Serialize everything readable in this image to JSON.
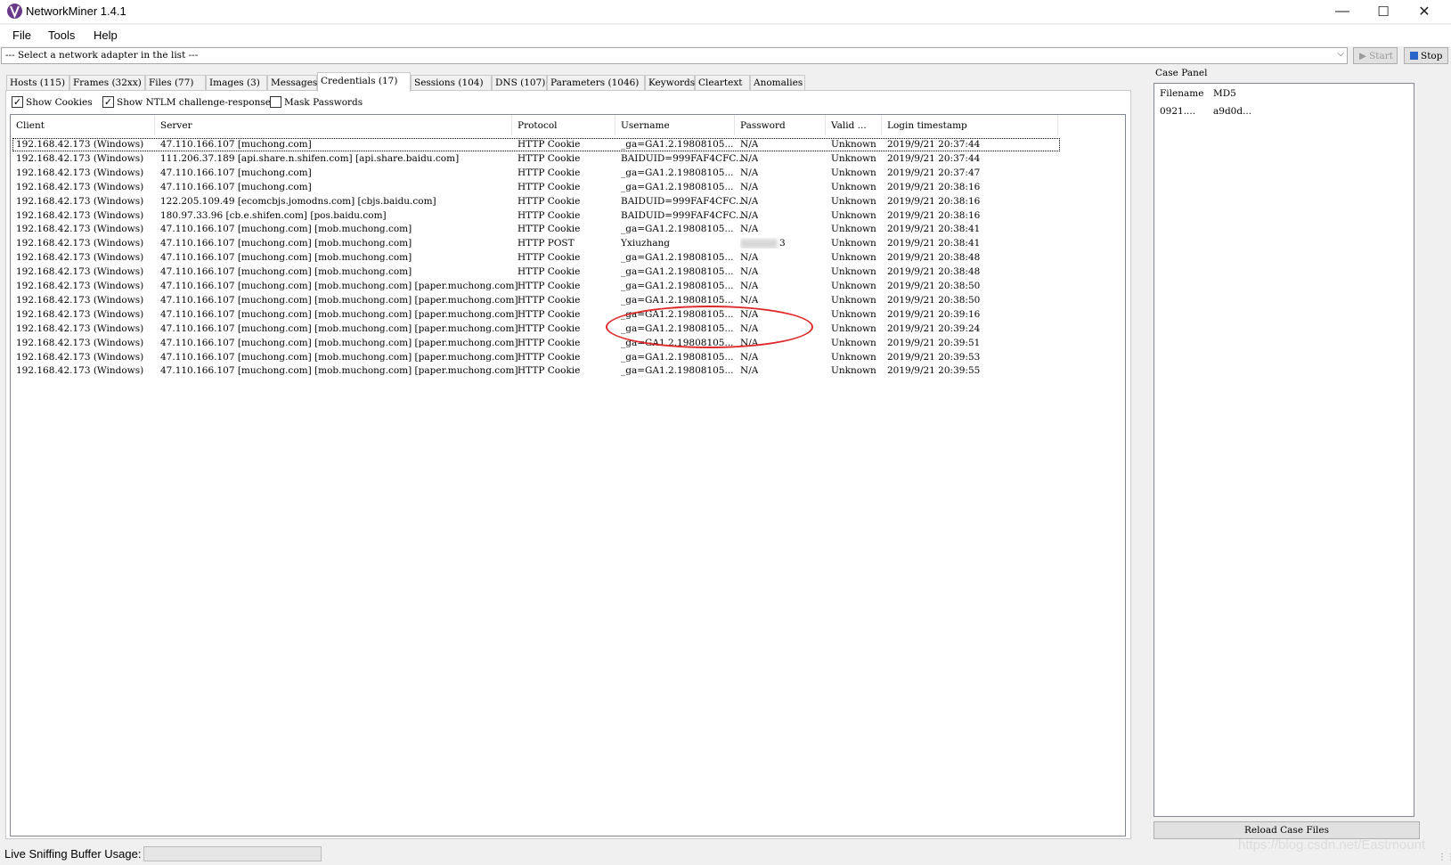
{
  "window": {
    "title": "NetworkMiner 1.4.1",
    "minimize": "—",
    "maximize": "☐",
    "close": "✕"
  },
  "menu": [
    "File",
    "Tools",
    "Help"
  ],
  "adapter": {
    "text": "--- Select a network adapter in the list ---"
  },
  "toolbar": {
    "start_label": "Start",
    "stop_label": "Stop"
  },
  "tabs": [
    "Hosts (115)",
    "Frames (32xx)",
    "Files (77)",
    "Images (3)",
    "Messages",
    "Credentials (17)",
    "Sessions (104)",
    "DNS (107)",
    "Parameters (1046)",
    "Keywords",
    "Cleartext",
    "Anomalies"
  ],
  "options": {
    "show_cookies": "Show Cookies",
    "show_ntlm": "Show NTLM challenge-response",
    "mask_passwords": "Mask Passwords"
  },
  "columns": [
    "Client",
    "Server",
    "Protocol",
    "Username",
    "Password",
    "Valid ...",
    "Login timestamp"
  ],
  "rows": [
    [
      "192.168.42.173 (Windows)",
      "47.110.166.107 [muchong.com]",
      "HTTP Cookie",
      "_ga=GA1.2.19808105...",
      "N/A",
      "Unknown",
      "2019/9/21 20:37:44"
    ],
    [
      "192.168.42.173 (Windows)",
      "111.206.37.189 [api.share.n.shifen.com] [api.share.baidu.com]",
      "HTTP Cookie",
      "BAIDUID=999FAF4CFC...",
      "N/A",
      "Unknown",
      "2019/9/21 20:37:44"
    ],
    [
      "192.168.42.173 (Windows)",
      "47.110.166.107 [muchong.com]",
      "HTTP Cookie",
      "_ga=GA1.2.19808105...",
      "N/A",
      "Unknown",
      "2019/9/21 20:37:47"
    ],
    [
      "192.168.42.173 (Windows)",
      "47.110.166.107 [muchong.com]",
      "HTTP Cookie",
      "_ga=GA1.2.19808105...",
      "N/A",
      "Unknown",
      "2019/9/21 20:38:16"
    ],
    [
      "192.168.42.173 (Windows)",
      "122.205.109.49 [ecomcbjs.jomodns.com] [cbjs.baidu.com]",
      "HTTP Cookie",
      "BAIDUID=999FAF4CFC...",
      "N/A",
      "Unknown",
      "2019/9/21 20:38:16"
    ],
    [
      "192.168.42.173 (Windows)",
      "180.97.33.96 [cb.e.shifen.com] [pos.baidu.com]",
      "HTTP Cookie",
      "BAIDUID=999FAF4CFC...",
      "N/A",
      "Unknown",
      "2019/9/21 20:38:16"
    ],
    [
      "192.168.42.173 (Windows)",
      "47.110.166.107 [muchong.com] [mob.muchong.com]",
      "HTTP Cookie",
      "_ga=GA1.2.19808105...",
      "N/A",
      "Unknown",
      "2019/9/21 20:38:41"
    ],
    [
      "192.168.42.173 (Windows)",
      "47.110.166.107 [muchong.com] [mob.muchong.com]",
      "HTTP POST",
      "Yxiuzhang",
      "3",
      "Unknown",
      "2019/9/21 20:38:41"
    ],
    [
      "192.168.42.173 (Windows)",
      "47.110.166.107 [muchong.com] [mob.muchong.com]",
      "HTTP Cookie",
      "_ga=GA1.2.19808105...",
      "N/A",
      "Unknown",
      "2019/9/21 20:38:48"
    ],
    [
      "192.168.42.173 (Windows)",
      "47.110.166.107 [muchong.com] [mob.muchong.com]",
      "HTTP Cookie",
      "_ga=GA1.2.19808105...",
      "N/A",
      "Unknown",
      "2019/9/21 20:38:48"
    ],
    [
      "192.168.42.173 (Windows)",
      "47.110.166.107 [muchong.com] [mob.muchong.com] [paper.muchong.com]",
      "HTTP Cookie",
      "_ga=GA1.2.19808105...",
      "N/A",
      "Unknown",
      "2019/9/21 20:38:50"
    ],
    [
      "192.168.42.173 (Windows)",
      "47.110.166.107 [muchong.com] [mob.muchong.com] [paper.muchong.com]",
      "HTTP Cookie",
      "_ga=GA1.2.19808105...",
      "N/A",
      "Unknown",
      "2019/9/21 20:38:50"
    ],
    [
      "192.168.42.173 (Windows)",
      "47.110.166.107 [muchong.com] [mob.muchong.com] [paper.muchong.com]",
      "HTTP Cookie",
      "_ga=GA1.2.19808105...",
      "N/A",
      "Unknown",
      "2019/9/21 20:39:16"
    ],
    [
      "192.168.42.173 (Windows)",
      "47.110.166.107 [muchong.com] [mob.muchong.com] [paper.muchong.com]",
      "HTTP Cookie",
      "_ga=GA1.2.19808105...",
      "N/A",
      "Unknown",
      "2019/9/21 20:39:24"
    ],
    [
      "192.168.42.173 (Windows)",
      "47.110.166.107 [muchong.com] [mob.muchong.com] [paper.muchong.com]",
      "HTTP Cookie",
      "_ga=GA1.2.19808105...",
      "N/A",
      "Unknown",
      "2019/9/21 20:39:51"
    ],
    [
      "192.168.42.173 (Windows)",
      "47.110.166.107 [muchong.com] [mob.muchong.com] [paper.muchong.com]",
      "HTTP Cookie",
      "_ga=GA1.2.19808105...",
      "N/A",
      "Unknown",
      "2019/9/21 20:39:53"
    ],
    [
      "192.168.42.173 (Windows)",
      "47.110.166.107 [muchong.com] [mob.muchong.com] [paper.muchong.com]",
      "HTTP Cookie",
      "_ga=GA1.2.19808105...",
      "N/A",
      "Unknown",
      "2019/9/21 20:39:55"
    ]
  ],
  "case_panel": {
    "label": "Case Panel",
    "columns": [
      "Filename",
      "MD5"
    ],
    "rows": [
      [
        "0921....",
        "a9d0d..."
      ]
    ],
    "reload_label": "Reload Case Files"
  },
  "status": {
    "label": "Live Sniffing Buffer Usage:"
  },
  "watermark": "https://blog.csdn.net/Eastmount",
  "colors": {
    "annotation": "#e0282a",
    "background": "#f0f0f0"
  }
}
